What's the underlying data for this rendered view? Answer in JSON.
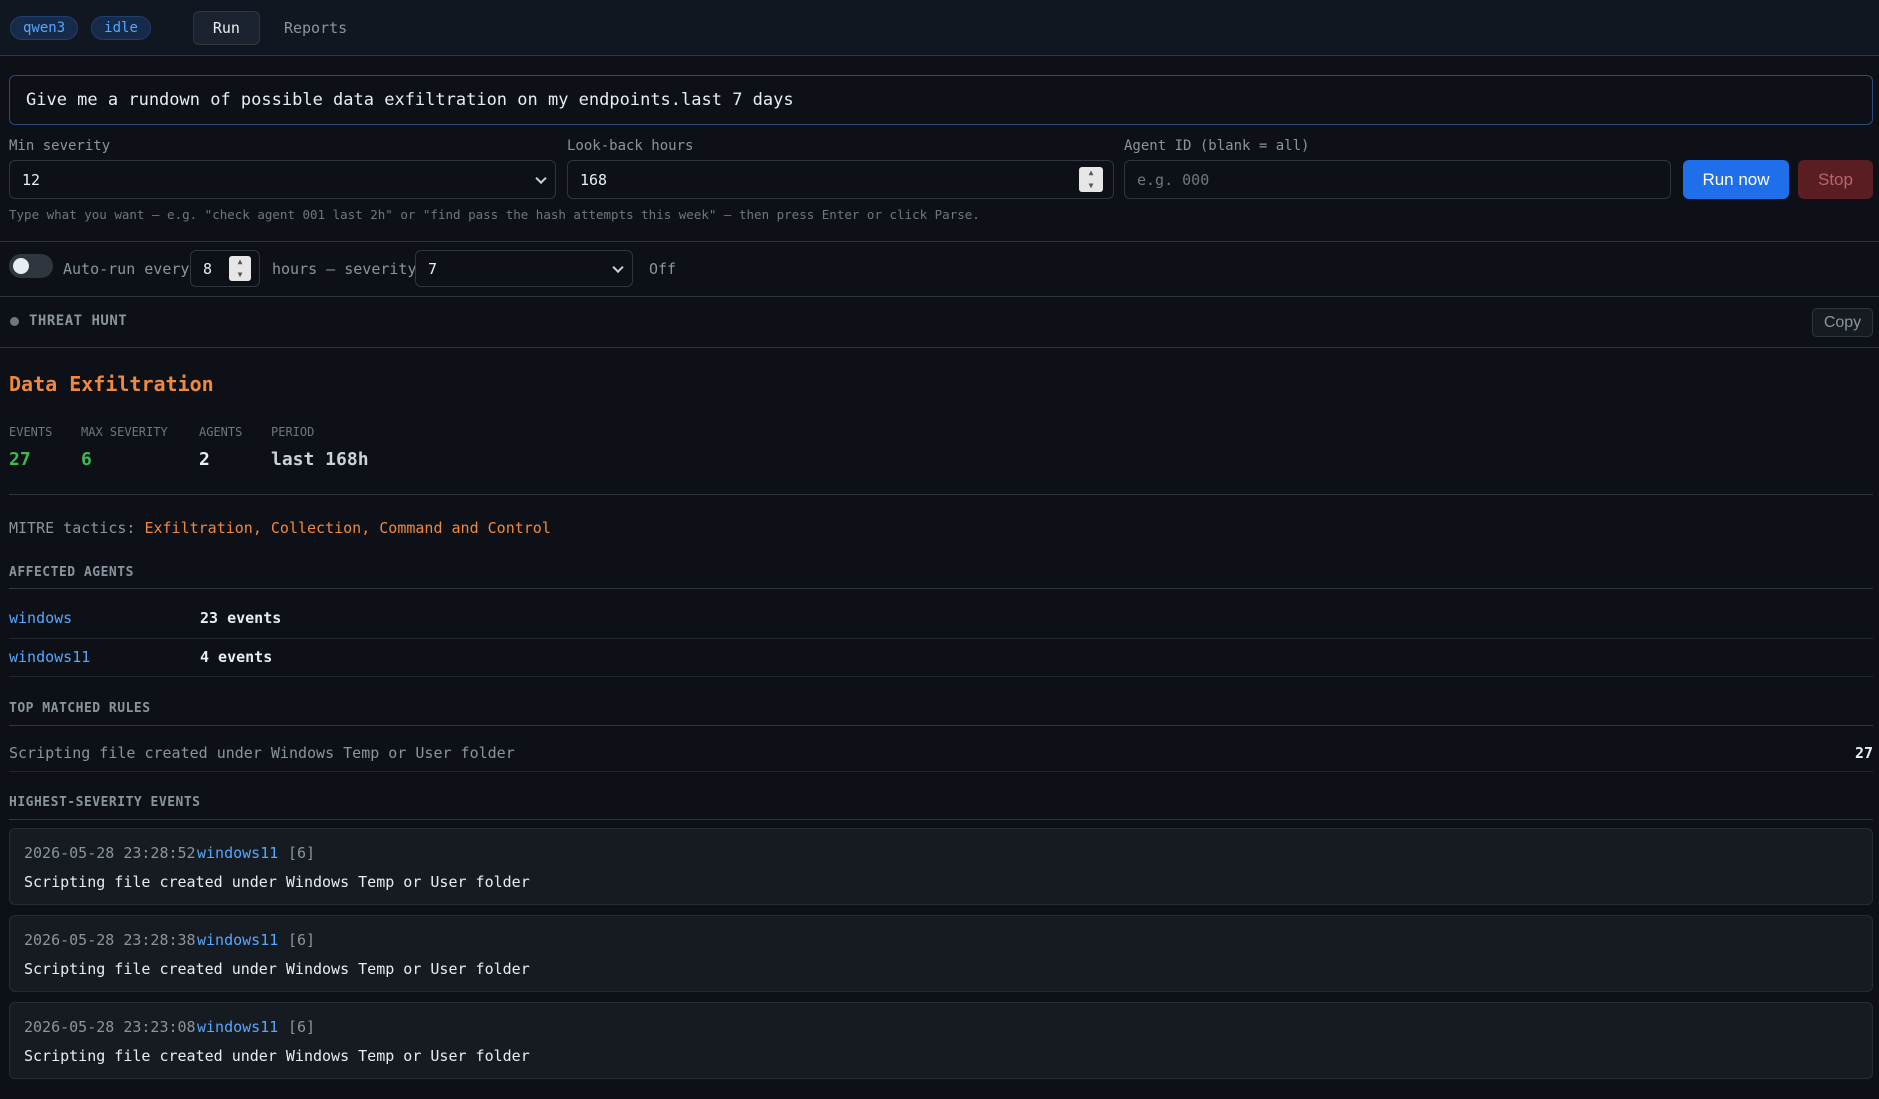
{
  "header": {
    "model_badge": "qwen3",
    "status_badge": "idle",
    "tabs": [
      {
        "label": "Run",
        "active": true
      },
      {
        "label": "Reports",
        "active": false
      }
    ]
  },
  "query": {
    "value": "Give me a rundown of possible data exfiltration on my endpoints.last 7 days"
  },
  "filters": {
    "min_severity_label": "Min severity",
    "min_severity_value": "12",
    "lookback_label": "Look-back hours",
    "lookback_value": "168",
    "agent_id_label": "Agent ID (blank = all)",
    "agent_id_placeholder": "e.g. 000",
    "run_button": "Run now",
    "stop_button": "Stop",
    "hint": "Type what you want — e.g. \"check agent 001 last 2h\" or \"find pass the hash attempts this week\" — then press Enter or click Parse."
  },
  "autorun": {
    "label_prefix": "Auto-run every",
    "hours_value": "8",
    "label_middle": "hours — severity",
    "severity_value": "7",
    "status": "Off"
  },
  "report": {
    "section_label": "THREAT HUNT",
    "copy_button": "Copy",
    "title": "Data Exfiltration",
    "stats": [
      {
        "label": "EVENTS",
        "value": "27",
        "color": "#3fb950"
      },
      {
        "label": "MAX SEVERITY",
        "value": "6",
        "color": "#3fb950"
      },
      {
        "label": "AGENTS",
        "value": "2",
        "color": "#e6edf3"
      },
      {
        "label": "PERIOD",
        "value": "last 168h",
        "color": "#c9d1d9"
      }
    ],
    "mitre_label": "MITRE tactics:",
    "mitre_tactics": [
      "Exfiltration",
      "Collection",
      "Command and Control"
    ],
    "affected_agents_label": "AFFECTED AGENTS",
    "agents": [
      {
        "name": "windows",
        "count": "23 events"
      },
      {
        "name": "windows11",
        "count": "4 events"
      }
    ],
    "top_rules_label": "TOP MATCHED RULES",
    "rules": [
      {
        "name": "Scripting file created under Windows Temp or User folder",
        "count": "27"
      }
    ],
    "events_label": "HIGHEST-SEVERITY EVENTS",
    "events": [
      {
        "timestamp": "2026-05-28 23:28:52",
        "agent": "windows11",
        "severity": "[6]",
        "description": "Scripting file created under Windows Temp or User folder"
      },
      {
        "timestamp": "2026-05-28 23:28:38",
        "agent": "windows11",
        "severity": "[6]",
        "description": "Scripting file created under Windows Temp or User folder"
      },
      {
        "timestamp": "2026-05-28 23:23:08",
        "agent": "windows11",
        "severity": "[6]",
        "description": "Scripting file created under Windows Temp or User folder"
      }
    ]
  }
}
